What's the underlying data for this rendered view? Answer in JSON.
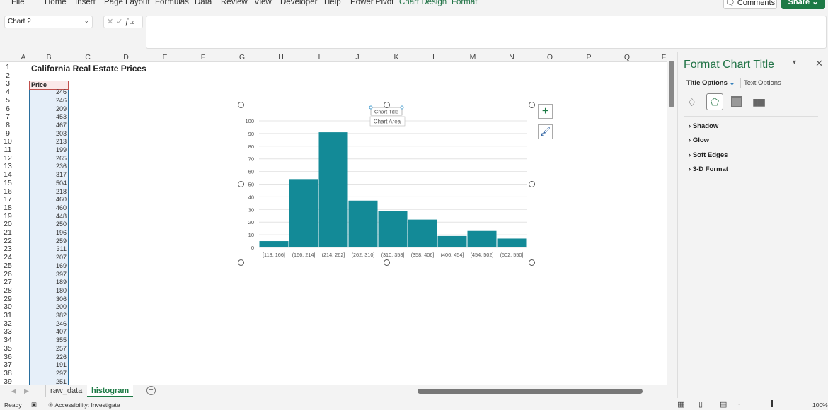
{
  "menu": [
    "File",
    "Home",
    "Insert",
    "Page Layout",
    "Formulas",
    "Data",
    "Review",
    "View",
    "Developer",
    "Help",
    "Power Pivot",
    "Chart Design",
    "Format"
  ],
  "comments_label": "Comments",
  "share_label": "Share",
  "name_box": "Chart 2",
  "formula_value": "",
  "columns": [
    "A",
    "B",
    "C",
    "D",
    "E",
    "F",
    "G",
    "H",
    "I",
    "J",
    "K",
    "L",
    "M",
    "N",
    "O",
    "P",
    "Q",
    "F"
  ],
  "sheet": {
    "title": "California Real Estate Prices",
    "header": "Price",
    "values": [
      246,
      246,
      209,
      453,
      467,
      203,
      213,
      199,
      265,
      236,
      317,
      504,
      218,
      460,
      460,
      448,
      250,
      196,
      259,
      311,
      207,
      169,
      397,
      189,
      180,
      306,
      200,
      382,
      246,
      407,
      355,
      257,
      226,
      191,
      297,
      251
    ]
  },
  "chart_data": {
    "type": "bar",
    "title": "Chart Title",
    "tooltip": "Chart Area",
    "categories": [
      "[118, 166]",
      "(166, 214]",
      "(214, 262]",
      "(262, 310]",
      "(310, 358]",
      "(358, 406]",
      "(406, 454]",
      "(454, 502]",
      "(502, 550]"
    ],
    "values": [
      5,
      54,
      91,
      37,
      29,
      22,
      9,
      13,
      7
    ],
    "ylim": [
      0,
      100
    ],
    "yticks": [
      0,
      10,
      20,
      30,
      40,
      50,
      60,
      70,
      80,
      90,
      100
    ],
    "grid": true,
    "color": "#138a97"
  },
  "pane": {
    "title": "Format Chart Title",
    "tab_active": "Title Options",
    "tab_other": "Text Options",
    "sections": [
      "Shadow",
      "Glow",
      "Soft Edges",
      "3-D Format"
    ]
  },
  "sheets": [
    "raw_data",
    "histogram"
  ],
  "active_sheet": "histogram",
  "status": {
    "ready": "Ready",
    "accessibility": "Accessibility: Investigate",
    "zoom": "100%"
  }
}
